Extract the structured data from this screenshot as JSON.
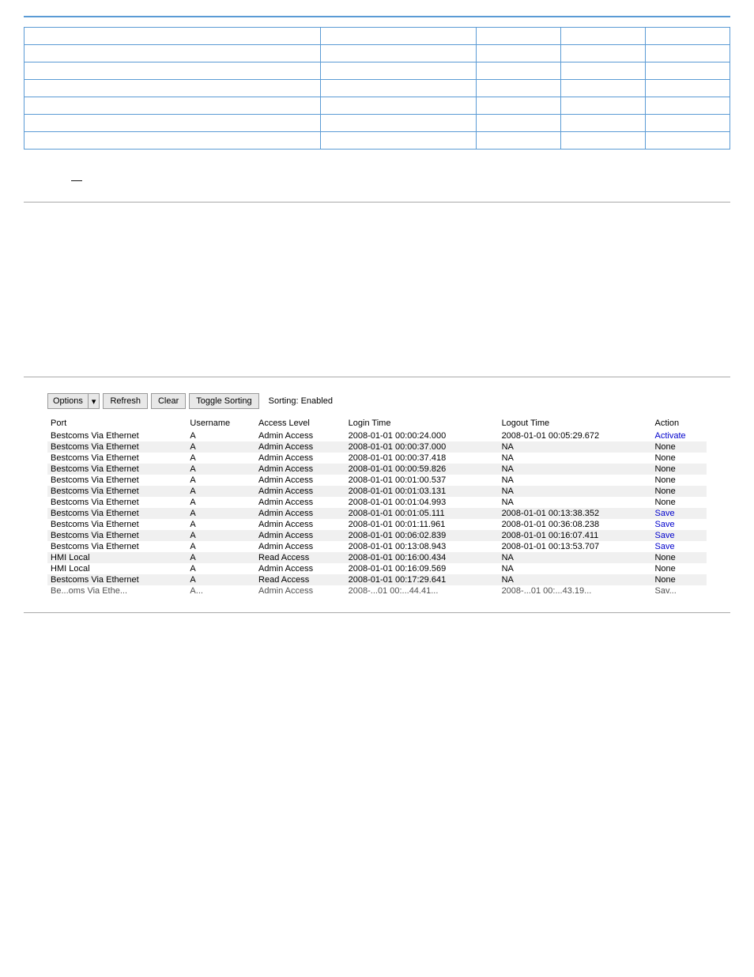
{
  "top_table": {
    "rows": [
      [
        "",
        "",
        "",
        "",
        ""
      ],
      [
        "",
        "",
        "",
        "",
        ""
      ],
      [
        "",
        "",
        "",
        "",
        ""
      ],
      [
        "",
        "",
        "",
        "",
        ""
      ],
      [
        "",
        "",
        "",
        "",
        ""
      ],
      [
        "",
        "",
        "",
        "",
        ""
      ],
      [
        "",
        "",
        "",
        "",
        ""
      ]
    ]
  },
  "toolbar": {
    "options_label": "Options",
    "arrow": "▾",
    "refresh_label": "Refresh",
    "clear_label": "Clear",
    "toggle_sorting_label": "Toggle Sorting",
    "sorting_status": "Sorting: Enabled"
  },
  "log_table": {
    "headers": [
      "Port",
      "Username",
      "Access Level",
      "Login Time",
      "Logout Time",
      "Action"
    ],
    "rows": [
      [
        "Bestcoms Via Ethernet",
        "A",
        "Admin Access",
        "2008-01-01 00:00:24.000",
        "2008-01-01 00:05:29.672",
        "Activate"
      ],
      [
        "Bestcoms Via Ethernet",
        "A",
        "Admin Access",
        "2008-01-01 00:00:37.000",
        "NA",
        "None"
      ],
      [
        "Bestcoms Via Ethernet",
        "A",
        "Admin Access",
        "2008-01-01 00:00:37.418",
        "NA",
        "None"
      ],
      [
        "Bestcoms Via Ethernet",
        "A",
        "Admin Access",
        "2008-01-01 00:00:59.826",
        "NA",
        "None"
      ],
      [
        "Bestcoms Via Ethernet",
        "A",
        "Admin Access",
        "2008-01-01 00:01:00.537",
        "NA",
        "None"
      ],
      [
        "Bestcoms Via Ethernet",
        "A",
        "Admin Access",
        "2008-01-01 00:01:03.131",
        "NA",
        "None"
      ],
      [
        "Bestcoms Via Ethernet",
        "A",
        "Admin Access",
        "2008-01-01 00:01:04.993",
        "NA",
        "None"
      ],
      [
        "Bestcoms Via Ethernet",
        "A",
        "Admin Access",
        "2008-01-01 00:01:05.111",
        "2008-01-01 00:13:38.352",
        "Save"
      ],
      [
        "Bestcoms Via Ethernet",
        "A",
        "Admin Access",
        "2008-01-01 00:01:11.961",
        "2008-01-01 00:36:08.238",
        "Save"
      ],
      [
        "Bestcoms Via Ethernet",
        "A",
        "Admin Access",
        "2008-01-01 00:06:02.839",
        "2008-01-01 00:16:07.411",
        "Save"
      ],
      [
        "Bestcoms Via Ethernet",
        "A",
        "Admin Access",
        "2008-01-01 00:13:08.943",
        "2008-01-01 00:13:53.707",
        "Save"
      ],
      [
        "HMI Local",
        "A",
        "Read Access",
        "2008-01-01 00:16:00.434",
        "NA",
        "None"
      ],
      [
        "HMI Local",
        "A",
        "Admin Access",
        "2008-01-01 00:16:09.569",
        "NA",
        "None"
      ],
      [
        "Bestcoms Via Ethernet",
        "A",
        "Read Access",
        "2008-01-01 00:17:29.641",
        "NA",
        "None"
      ],
      [
        "Be...oms Via Ethe...",
        "A...",
        "Admin Access",
        "2008-...01 00:...44.41...",
        "2008-...01 00:...43.19...",
        "Sav..."
      ]
    ]
  }
}
